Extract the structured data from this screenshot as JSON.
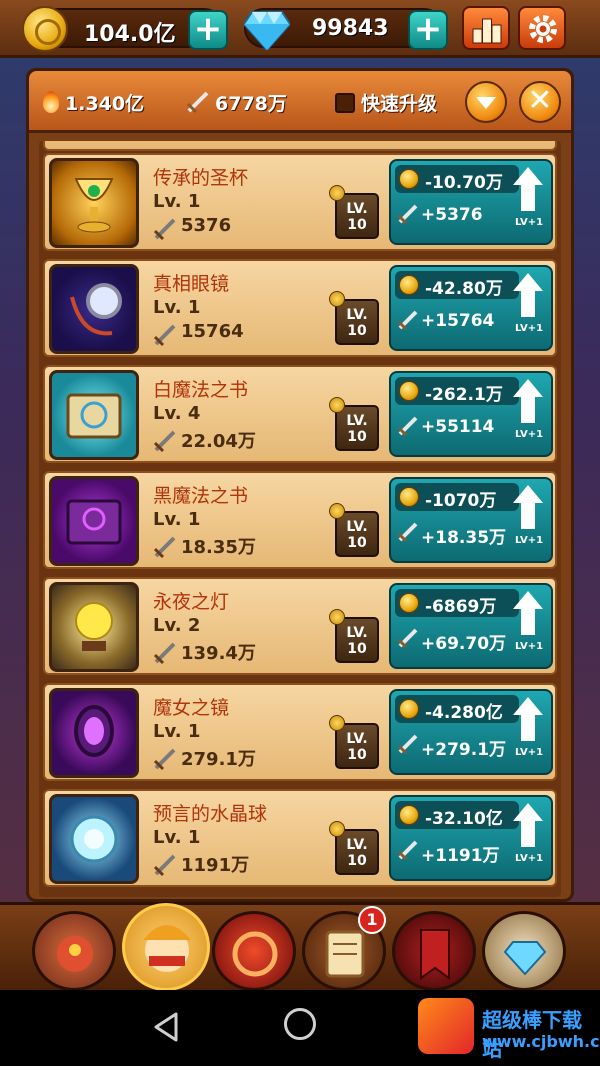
{
  "top_bar": {
    "gold_amount": "104.0亿",
    "gem_amount": "99843",
    "plus_label": "+"
  },
  "panel": {
    "power": "1.340亿",
    "attack": "6778万",
    "quick_upgrade_label": "快速升级",
    "close_label": "✕"
  },
  "items": [
    {
      "name": "传承的圣杯",
      "level": "Lv. 1",
      "attack": "5376",
      "lock_label": "LV. 10",
      "cost": "-10.70万",
      "gain": "+5376",
      "lv_plus": "LV+1"
    },
    {
      "name": "真相眼镜",
      "level": "Lv. 1",
      "attack": "15764",
      "lock_label": "LV. 10",
      "cost": "-42.80万",
      "gain": "+15764",
      "lv_plus": "LV+1"
    },
    {
      "name": "白魔法之书",
      "level": "Lv. 4",
      "attack": "22.04万",
      "lock_label": "LV. 10",
      "cost": "-262.1万",
      "gain": "+55114",
      "lv_plus": "LV+1"
    },
    {
      "name": "黑魔法之书",
      "level": "Lv. 1",
      "attack": "18.35万",
      "lock_label": "LV. 10",
      "cost": "-1070万",
      "gain": "+18.35万",
      "lv_plus": "LV+1"
    },
    {
      "name": "永夜之灯",
      "level": "Lv. 2",
      "attack": "139.4万",
      "lock_label": "LV. 10",
      "cost": "-6869万",
      "gain": "+69.70万",
      "lv_plus": "LV+1"
    },
    {
      "name": "魔女之镜",
      "level": "Lv. 1",
      "attack": "279.1万",
      "lock_label": "LV. 10",
      "cost": "-4.280亿",
      "gain": "+279.1万",
      "lv_plus": "LV+1"
    },
    {
      "name": "预言的水晶球",
      "level": "Lv. 1",
      "attack": "1191万",
      "lock_label": "LV. 10",
      "cost": "-32.10亿",
      "gain": "+1191万",
      "lv_plus": "LV+1"
    }
  ],
  "bottom_nav": {
    "badge_count": "1"
  },
  "watermark": {
    "title": "超级棒下载站",
    "url": "www.cjbwh.com"
  },
  "colors": {
    "accent_teal": "#1fa7b0",
    "gold": "#e8a90f",
    "item_name": "#b2340c"
  }
}
